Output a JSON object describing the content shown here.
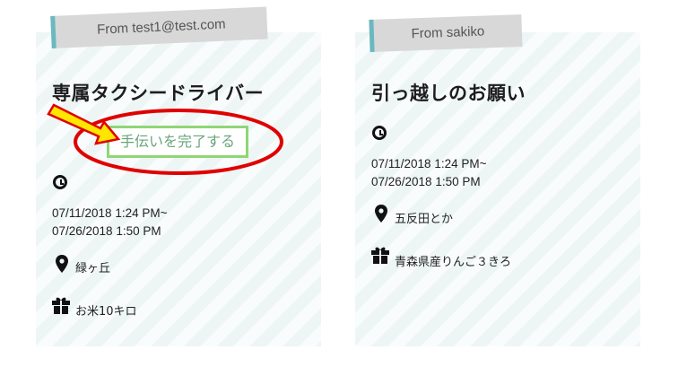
{
  "cards": [
    {
      "from_label": "From test1@test.com",
      "title": "専属タクシードライバー",
      "action_button": "手伝いを完了する",
      "date_start": "07/11/2018 1:24 PM~",
      "date_end": "07/26/2018 1:50 PM",
      "location": "緑ヶ丘",
      "reward": "お米10キロ"
    },
    {
      "from_label": "From sakiko",
      "title": "引っ越しのお願い",
      "date_start": "07/11/2018 1:24 PM~",
      "date_end": "07/26/2018 1:50 PM",
      "location": "五反田とか",
      "reward": "青森県産りんご３きろ"
    }
  ],
  "icons": {
    "clock": "clock-icon",
    "location": "map-pin-icon",
    "reward": "gift-icon"
  },
  "colors": {
    "tag_accent": "#6bb9c0",
    "button_border": "#8fd675",
    "button_text": "#6aa57a",
    "annotation_red": "#e00000",
    "annotation_yellow": "#ffe600"
  }
}
